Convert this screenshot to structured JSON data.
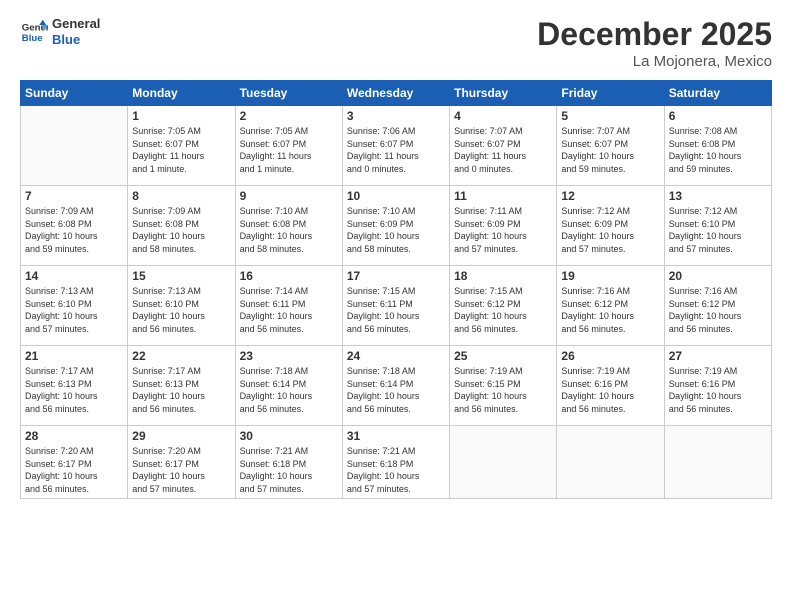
{
  "logo": {
    "line1": "General",
    "line2": "Blue"
  },
  "title": "December 2025",
  "subtitle": "La Mojonera, Mexico",
  "days_header": [
    "Sunday",
    "Monday",
    "Tuesday",
    "Wednesday",
    "Thursday",
    "Friday",
    "Saturday"
  ],
  "weeks": [
    [
      {
        "day": "",
        "info": ""
      },
      {
        "day": "1",
        "info": "Sunrise: 7:05 AM\nSunset: 6:07 PM\nDaylight: 11 hours\nand 1 minute."
      },
      {
        "day": "2",
        "info": "Sunrise: 7:05 AM\nSunset: 6:07 PM\nDaylight: 11 hours\nand 1 minute."
      },
      {
        "day": "3",
        "info": "Sunrise: 7:06 AM\nSunset: 6:07 PM\nDaylight: 11 hours\nand 0 minutes."
      },
      {
        "day": "4",
        "info": "Sunrise: 7:07 AM\nSunset: 6:07 PM\nDaylight: 11 hours\nand 0 minutes."
      },
      {
        "day": "5",
        "info": "Sunrise: 7:07 AM\nSunset: 6:07 PM\nDaylight: 10 hours\nand 59 minutes."
      },
      {
        "day": "6",
        "info": "Sunrise: 7:08 AM\nSunset: 6:08 PM\nDaylight: 10 hours\nand 59 minutes."
      }
    ],
    [
      {
        "day": "7",
        "info": "Sunrise: 7:09 AM\nSunset: 6:08 PM\nDaylight: 10 hours\nand 59 minutes."
      },
      {
        "day": "8",
        "info": "Sunrise: 7:09 AM\nSunset: 6:08 PM\nDaylight: 10 hours\nand 58 minutes."
      },
      {
        "day": "9",
        "info": "Sunrise: 7:10 AM\nSunset: 6:08 PM\nDaylight: 10 hours\nand 58 minutes."
      },
      {
        "day": "10",
        "info": "Sunrise: 7:10 AM\nSunset: 6:09 PM\nDaylight: 10 hours\nand 58 minutes."
      },
      {
        "day": "11",
        "info": "Sunrise: 7:11 AM\nSunset: 6:09 PM\nDaylight: 10 hours\nand 57 minutes."
      },
      {
        "day": "12",
        "info": "Sunrise: 7:12 AM\nSunset: 6:09 PM\nDaylight: 10 hours\nand 57 minutes."
      },
      {
        "day": "13",
        "info": "Sunrise: 7:12 AM\nSunset: 6:10 PM\nDaylight: 10 hours\nand 57 minutes."
      }
    ],
    [
      {
        "day": "14",
        "info": "Sunrise: 7:13 AM\nSunset: 6:10 PM\nDaylight: 10 hours\nand 57 minutes."
      },
      {
        "day": "15",
        "info": "Sunrise: 7:13 AM\nSunset: 6:10 PM\nDaylight: 10 hours\nand 56 minutes."
      },
      {
        "day": "16",
        "info": "Sunrise: 7:14 AM\nSunset: 6:11 PM\nDaylight: 10 hours\nand 56 minutes."
      },
      {
        "day": "17",
        "info": "Sunrise: 7:15 AM\nSunset: 6:11 PM\nDaylight: 10 hours\nand 56 minutes."
      },
      {
        "day": "18",
        "info": "Sunrise: 7:15 AM\nSunset: 6:12 PM\nDaylight: 10 hours\nand 56 minutes."
      },
      {
        "day": "19",
        "info": "Sunrise: 7:16 AM\nSunset: 6:12 PM\nDaylight: 10 hours\nand 56 minutes."
      },
      {
        "day": "20",
        "info": "Sunrise: 7:16 AM\nSunset: 6:12 PM\nDaylight: 10 hours\nand 56 minutes."
      }
    ],
    [
      {
        "day": "21",
        "info": "Sunrise: 7:17 AM\nSunset: 6:13 PM\nDaylight: 10 hours\nand 56 minutes."
      },
      {
        "day": "22",
        "info": "Sunrise: 7:17 AM\nSunset: 6:13 PM\nDaylight: 10 hours\nand 56 minutes."
      },
      {
        "day": "23",
        "info": "Sunrise: 7:18 AM\nSunset: 6:14 PM\nDaylight: 10 hours\nand 56 minutes."
      },
      {
        "day": "24",
        "info": "Sunrise: 7:18 AM\nSunset: 6:14 PM\nDaylight: 10 hours\nand 56 minutes."
      },
      {
        "day": "25",
        "info": "Sunrise: 7:19 AM\nSunset: 6:15 PM\nDaylight: 10 hours\nand 56 minutes."
      },
      {
        "day": "26",
        "info": "Sunrise: 7:19 AM\nSunset: 6:16 PM\nDaylight: 10 hours\nand 56 minutes."
      },
      {
        "day": "27",
        "info": "Sunrise: 7:19 AM\nSunset: 6:16 PM\nDaylight: 10 hours\nand 56 minutes."
      }
    ],
    [
      {
        "day": "28",
        "info": "Sunrise: 7:20 AM\nSunset: 6:17 PM\nDaylight: 10 hours\nand 56 minutes."
      },
      {
        "day": "29",
        "info": "Sunrise: 7:20 AM\nSunset: 6:17 PM\nDaylight: 10 hours\nand 57 minutes."
      },
      {
        "day": "30",
        "info": "Sunrise: 7:21 AM\nSunset: 6:18 PM\nDaylight: 10 hours\nand 57 minutes."
      },
      {
        "day": "31",
        "info": "Sunrise: 7:21 AM\nSunset: 6:18 PM\nDaylight: 10 hours\nand 57 minutes."
      },
      {
        "day": "",
        "info": ""
      },
      {
        "day": "",
        "info": ""
      },
      {
        "day": "",
        "info": ""
      }
    ]
  ]
}
